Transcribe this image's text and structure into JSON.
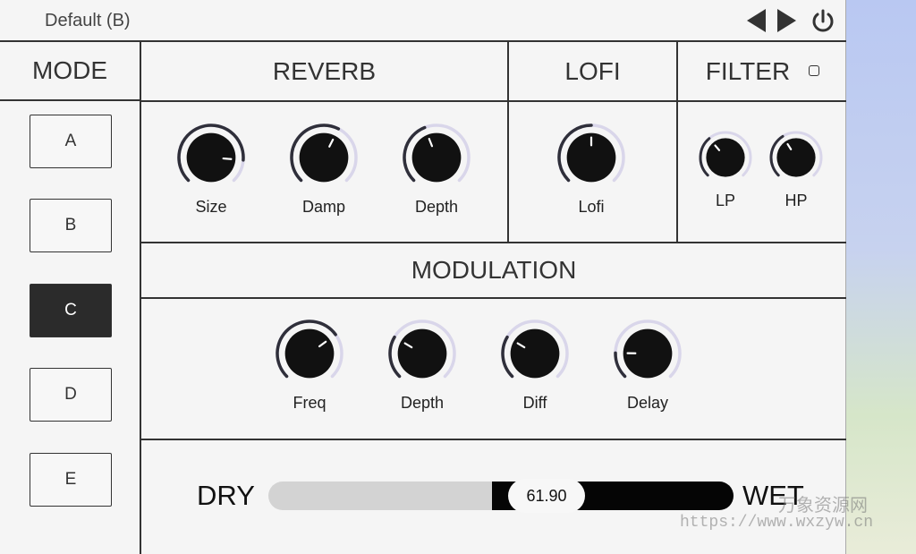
{
  "header": {
    "preset_name": "Default (B)"
  },
  "mode": {
    "title": "MODE",
    "buttons": [
      "A",
      "B",
      "C",
      "D",
      "E"
    ],
    "selected": "C"
  },
  "reverb": {
    "title": "REVERB",
    "knobs": [
      {
        "label": "Size",
        "value": 0.85
      },
      {
        "label": "Damp",
        "value": 0.6
      },
      {
        "label": "Depth",
        "value": 0.42
      }
    ]
  },
  "lofi": {
    "title": "LOFI",
    "knobs": [
      {
        "label": "Lofi",
        "value": 0.5
      }
    ]
  },
  "filter": {
    "title": "FILTER",
    "knobs": [
      {
        "label": "LP",
        "value": 0.35
      },
      {
        "label": "HP",
        "value": 0.38
      }
    ]
  },
  "modulation": {
    "title": "MODULATION",
    "knobs": [
      {
        "label": "Freq",
        "value": 0.7
      },
      {
        "label": "Depth",
        "value": 0.28
      },
      {
        "label": "Diff",
        "value": 0.28
      },
      {
        "label": "Delay",
        "value": 0.17
      }
    ]
  },
  "mix": {
    "dry_label": "DRY",
    "wet_label": "WET",
    "value_text": "61.90",
    "value": 0.619
  },
  "watermark": {
    "line1": "万象资源网",
    "line2": "https://www.wxzyw.cn"
  },
  "colors": {
    "knob_body": "#111111",
    "knob_arc": "#2f2f3a",
    "knob_track": "#d9d6ea",
    "active_mode": "#2b2b2b"
  }
}
